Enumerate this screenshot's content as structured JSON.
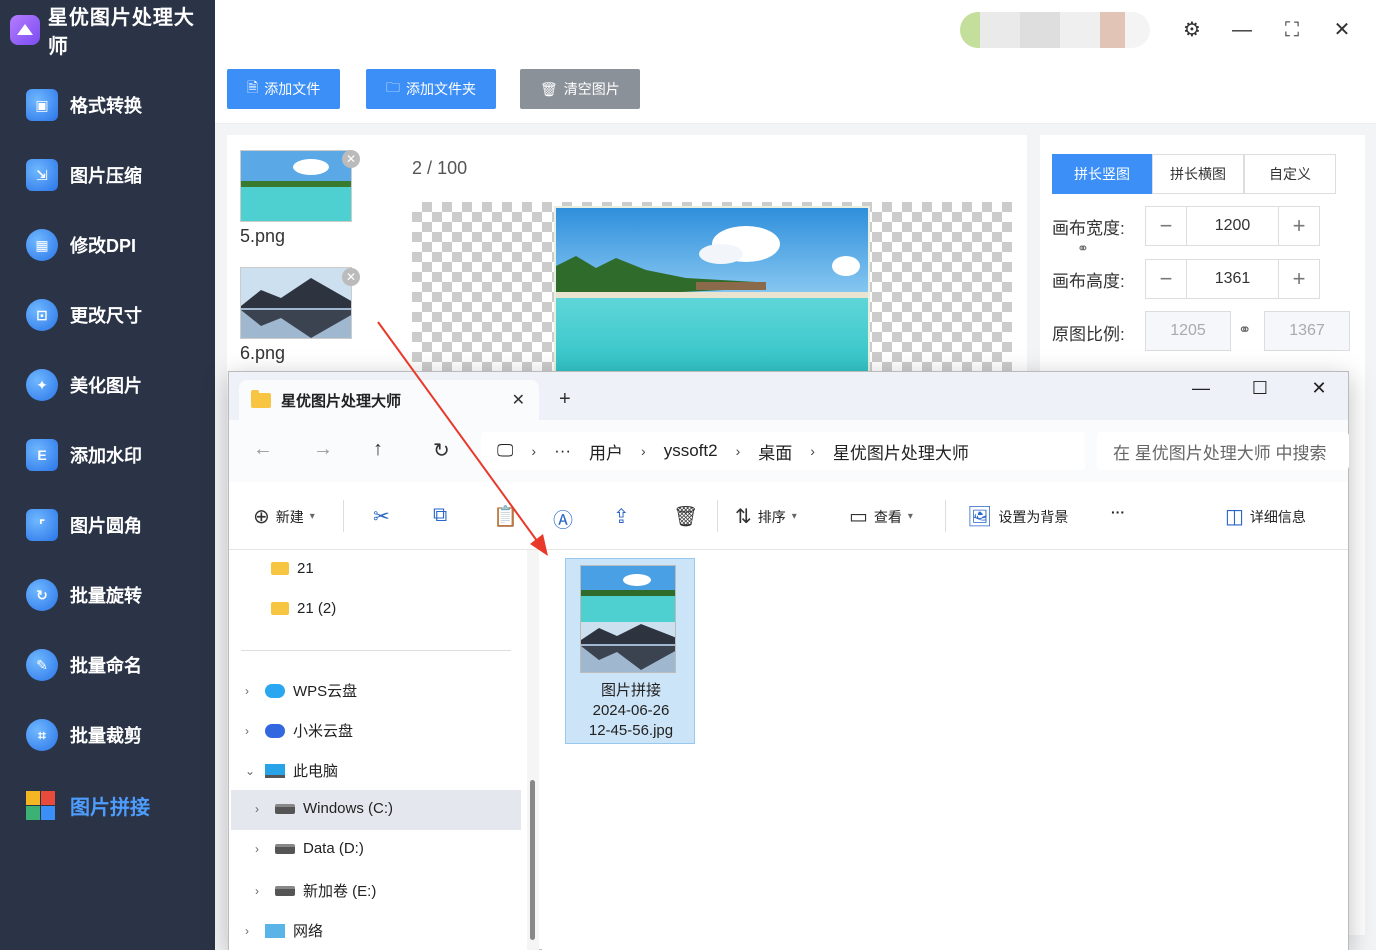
{
  "app": {
    "title": "星优图片处理大师",
    "nav": [
      {
        "label": "格式转换",
        "icon": "image-convert-icon"
      },
      {
        "label": "图片压缩",
        "icon": "compress-icon"
      },
      {
        "label": "修改DPI",
        "icon": "dpi-icon"
      },
      {
        "label": "更改尺寸",
        "icon": "resize-icon"
      },
      {
        "label": "美化图片",
        "icon": "beautify-icon"
      },
      {
        "label": "添加水印",
        "icon": "watermark-icon"
      },
      {
        "label": "图片圆角",
        "icon": "round-corner-icon"
      },
      {
        "label": "批量旋转",
        "icon": "rotate-icon"
      },
      {
        "label": "批量命名",
        "icon": "rename-icon"
      },
      {
        "label": "批量裁剪",
        "icon": "crop-icon"
      },
      {
        "label": "图片拼接",
        "icon": "puzzle-icon",
        "active": true
      }
    ]
  },
  "toolbar": {
    "add_file": "添加文件",
    "add_folder": "添加文件夹",
    "clear": "清空图片"
  },
  "thumbs": [
    {
      "name": "5.png"
    },
    {
      "name": "6.png"
    }
  ],
  "preview": {
    "current": "2",
    "sep": "/",
    "total": "100"
  },
  "settings": {
    "modes": [
      "拼长竖图",
      "拼长横图",
      "自定义"
    ],
    "active_mode": "拼长竖图",
    "width_label": "画布宽度:",
    "width_value": "1200",
    "height_label": "画布高度:",
    "height_value": "1361",
    "ratio_label": "原图比例:",
    "ratio_w": "1205",
    "ratio_h": "1367"
  },
  "explorer": {
    "tab_title": "星优图片处理大师",
    "breadcrumb": [
      "用户",
      "yssoft2",
      "桌面",
      "星优图片处理大师"
    ],
    "ellipsis": "···",
    "search_placeholder": "在 星优图片处理大师 中搜索",
    "commands": {
      "new": "新建",
      "sort": "排序",
      "view": "查看",
      "set_bg": "设置为背景",
      "more": "···",
      "details": "详细信息"
    },
    "tree": {
      "folder1": "21",
      "folder2": "21 (2)",
      "wps": "WPS云盘",
      "mi": "小米云盘",
      "pc": "此电脑",
      "c": "Windows (C:)",
      "d": "Data (D:)",
      "e": "新加卷 (E:)",
      "net": "网络"
    },
    "file": {
      "line1": "图片拼接",
      "line2": "2024-06-26",
      "line3": "12-45-56.jpg"
    }
  },
  "colors": {
    "sidebar": "#2b3446",
    "accent": "#3b8ff7",
    "arrow": "#e8392b"
  }
}
